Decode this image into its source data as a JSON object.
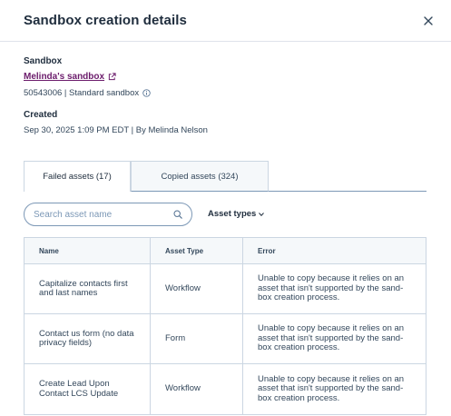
{
  "header": {
    "title": "Sandbox creation details",
    "close_icon": "close-icon"
  },
  "sandbox": {
    "label": "Sandbox",
    "name": "Melinda's sandbox",
    "link_icon": "external-link-icon",
    "details": "50543006 | Standard sandbox",
    "info_icon": "info-icon"
  },
  "created": {
    "label": "Created",
    "value": "Sep 30, 2025 1:09 PM EDT | By Melinda Nelson"
  },
  "tabs": [
    {
      "label": "Failed assets (17)",
      "active": true
    },
    {
      "label": "Copied assets (324)",
      "active": false
    }
  ],
  "search": {
    "placeholder": "Search asset name",
    "value": "",
    "icon": "search-icon"
  },
  "filter": {
    "label": "Asset types",
    "icon": "caret-down-icon"
  },
  "table": {
    "headers": [
      "Name",
      "Asset Type",
      "Error"
    ],
    "rows": [
      {
        "name": "Capitalize contacts first and last names",
        "type": "Workflow",
        "error": "Unable to copy because it relies on an asset that isn't supported by the sand-box creation process."
      },
      {
        "name": "Contact us form (no data privacy fields)",
        "type": "Form",
        "error": "Unable to copy because it relies on an asset that isn't supported by the sand-box creation process."
      },
      {
        "name": "Create Lead Upon Contact LCS Update",
        "type": "Workflow",
        "error": "Unable to copy because it relies on an asset that isn't supported by the sand-box creation process."
      }
    ]
  },
  "colors": {
    "link": "#6b1b6b",
    "text": "#33475b",
    "border": "#cbd6e2",
    "header_bg": "#f5f8fa"
  }
}
